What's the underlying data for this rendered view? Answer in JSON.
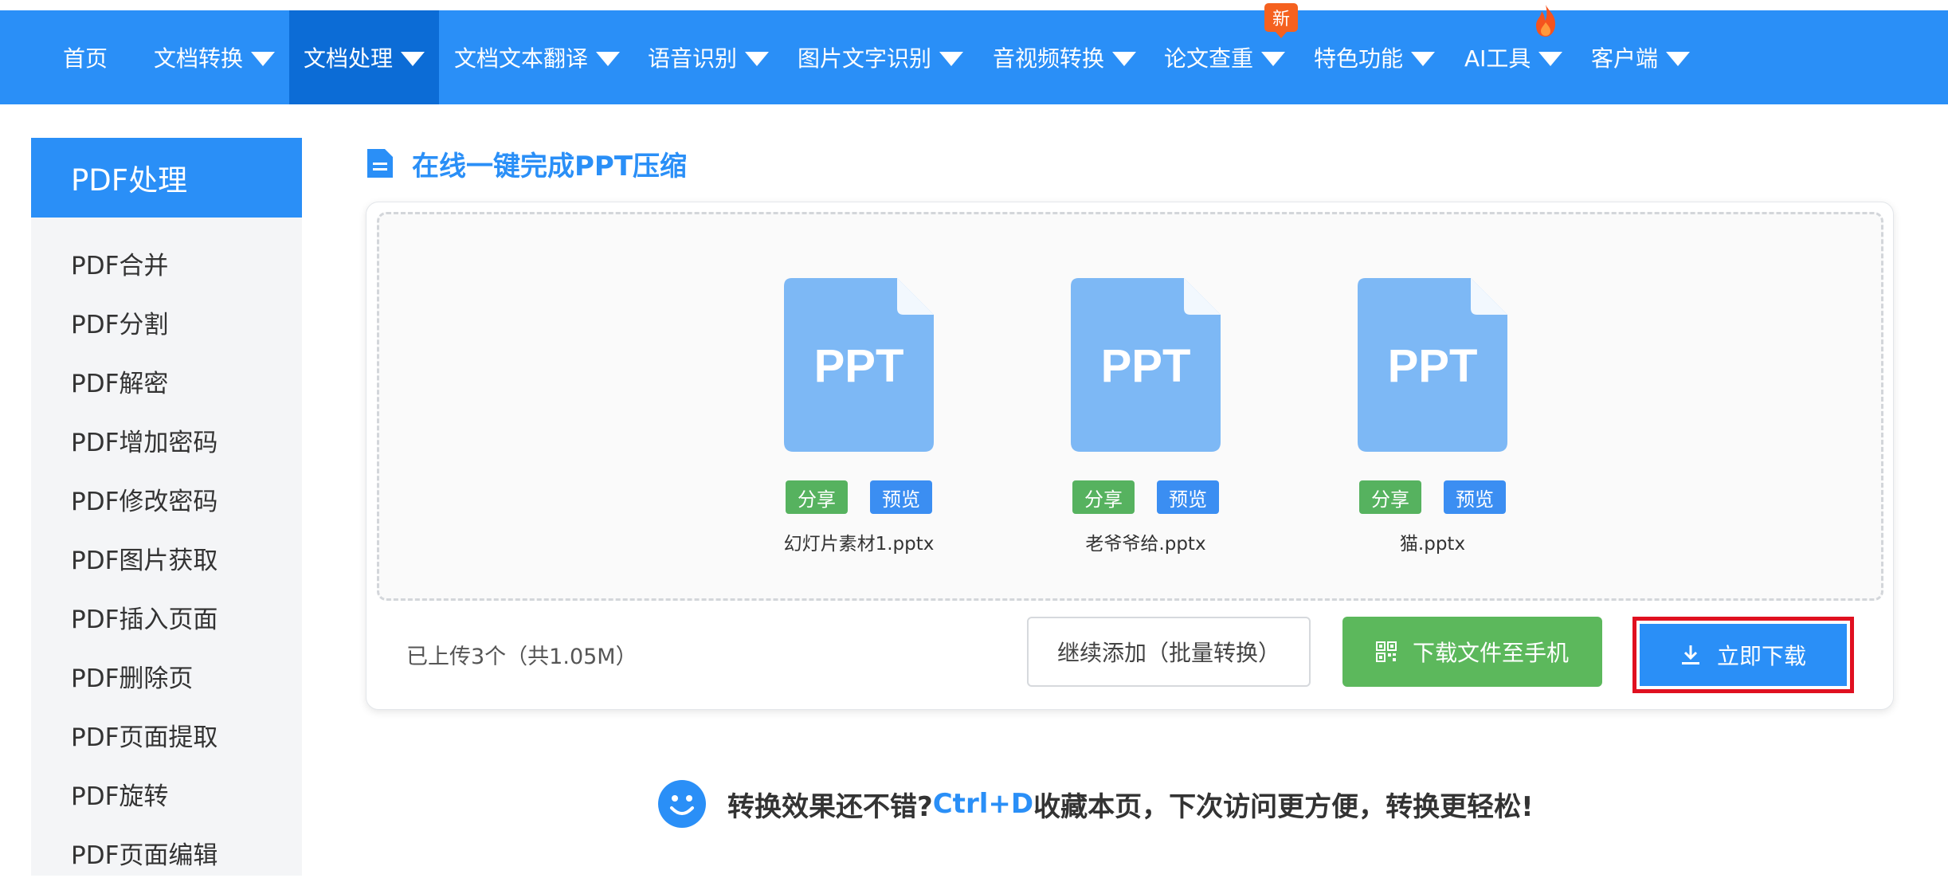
{
  "nav": {
    "items": [
      {
        "label": "首页",
        "caret": false
      },
      {
        "label": "文档转换",
        "caret": true
      },
      {
        "label": "文档处理",
        "caret": true,
        "active": true
      },
      {
        "label": "文档文本翻译",
        "caret": true
      },
      {
        "label": "语音识别",
        "caret": true
      },
      {
        "label": "图片文字识别",
        "caret": true
      },
      {
        "label": "音视频转换",
        "caret": true
      },
      {
        "label": "论文查重",
        "caret": true
      },
      {
        "label": "特色功能",
        "caret": true
      },
      {
        "label": "AI工具",
        "caret": true
      },
      {
        "label": "客户端",
        "caret": true
      }
    ],
    "new_badge": "新"
  },
  "sidebar": {
    "title": "PDF处理",
    "items": [
      "PDF合并",
      "PDF分割",
      "PDF解密",
      "PDF增加密码",
      "PDF修改密码",
      "PDF图片获取",
      "PDF插入页面",
      "PDF删除页",
      "PDF页面提取",
      "PDF旋转",
      "PDF页面编辑"
    ]
  },
  "main": {
    "title": "在线一键完成PPT压缩",
    "files": [
      {
        "icon_text": "PPT",
        "name": "幻灯片素材1.pptx"
      },
      {
        "icon_text": "PPT",
        "name": "老爷爷给.pptx"
      },
      {
        "icon_text": "PPT",
        "name": "猫.pptx"
      }
    ],
    "share_label": "分享",
    "preview_label": "预览",
    "upload_status": "已上传3个（共1.05M）",
    "continue_label": "继续添加（批量转换）",
    "phone_label": "下载文件至手机",
    "download_label": "立即下载"
  },
  "tip": {
    "prefix": "转换效果还不错?",
    "shortcut": "Ctrl+D",
    "suffix": "收藏本页，下次访问更方便，转换更轻松!"
  },
  "colors": {
    "brand_blue": "#2a8ff7",
    "active_nav": "#0c6cd6",
    "share_green": "#56b25f",
    "highlight_red": "#e01020"
  }
}
